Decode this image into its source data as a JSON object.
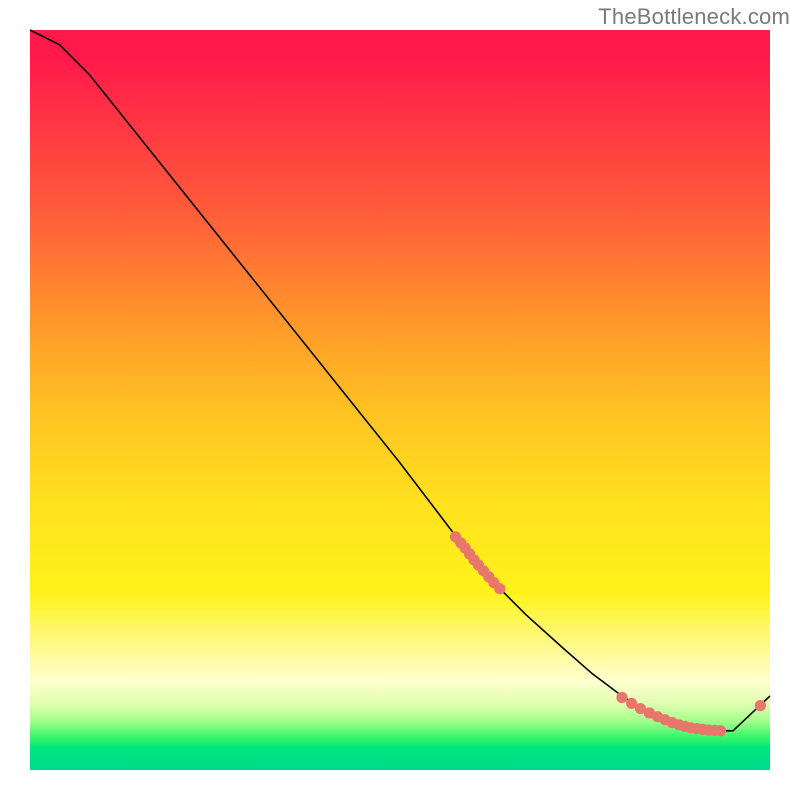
{
  "attribution": "TheBottleneck.com",
  "chart_data": {
    "type": "line",
    "title": "",
    "xlabel": "",
    "ylabel": "",
    "xlim": [
      0,
      100
    ],
    "ylim": [
      0,
      100
    ],
    "curve": {
      "x": [
        0,
        4,
        8,
        12,
        20,
        30,
        40,
        50,
        58,
        63,
        67,
        72,
        76,
        80,
        84,
        88,
        92,
        95,
        100
      ],
      "y": [
        100,
        98,
        94,
        89,
        79,
        66.5,
        54,
        41.5,
        31,
        25,
        21,
        16.5,
        13,
        10,
        7.5,
        6,
        5.3,
        5.3,
        10
      ]
    },
    "series": [
      {
        "name": "cluster-upper",
        "x": [
          57.5,
          58.2,
          58.8,
          59.4,
          60.0,
          60.6,
          61.3,
          62.0,
          62.7,
          63.5
        ],
        "y": [
          31.5,
          30.7,
          30.0,
          29.2,
          28.4,
          27.7,
          26.9,
          26.1,
          25.3,
          24.5
        ]
      },
      {
        "name": "cluster-lower",
        "x": [
          80.0,
          81.3,
          82.5,
          83.7,
          84.8,
          85.8,
          86.8,
          87.7,
          88.5,
          89.3,
          90.1,
          90.9,
          91.7,
          92.5,
          93.3
        ],
        "y": [
          9.8,
          9.0,
          8.3,
          7.7,
          7.2,
          6.8,
          6.4,
          6.1,
          5.9,
          5.7,
          5.6,
          5.5,
          5.4,
          5.35,
          5.3
        ]
      },
      {
        "name": "point-end",
        "x": [
          98.7
        ],
        "y": [
          8.7
        ]
      }
    ],
    "marker_radius_px": 5.6,
    "colors": {
      "curve": "#000000",
      "marker": "#e8766b"
    }
  }
}
